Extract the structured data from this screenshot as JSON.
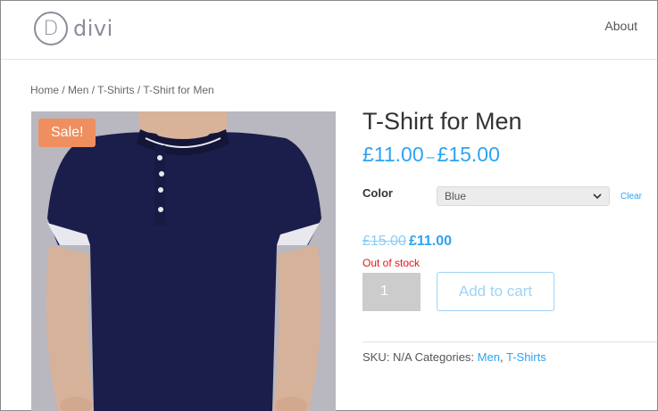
{
  "header": {
    "logo_letter": "D",
    "logo_text": "divi",
    "nav_about": "About"
  },
  "breadcrumb": {
    "home": "Home",
    "men": "Men",
    "tshirts": "T-Shirts",
    "current": "T-Shirt for Men",
    "separator": " / "
  },
  "product": {
    "sale_badge": "Sale!",
    "title": "T-Shirt for Men",
    "price_min": "£11.00",
    "price_dash": "–",
    "price_max": "£15.00",
    "color_label": "Color",
    "color_selected": "Blue",
    "clear_label": "Clear",
    "old_price": "£15.00",
    "new_price": "£11.00",
    "stock_status": "Out of stock",
    "quantity": "1",
    "add_to_cart": "Add to cart",
    "sku_label": "SKU:",
    "sku_value": "N/A",
    "categories_label": "Categories:",
    "category_1": "Men",
    "category_sep": ", ",
    "category_2": "T-Shirts"
  },
  "colors": {
    "accent": "#2ea3f2",
    "sale_badge": "#ef8f5f",
    "out_of_stock": "#e21616",
    "shirt": "#1b1e4a"
  }
}
